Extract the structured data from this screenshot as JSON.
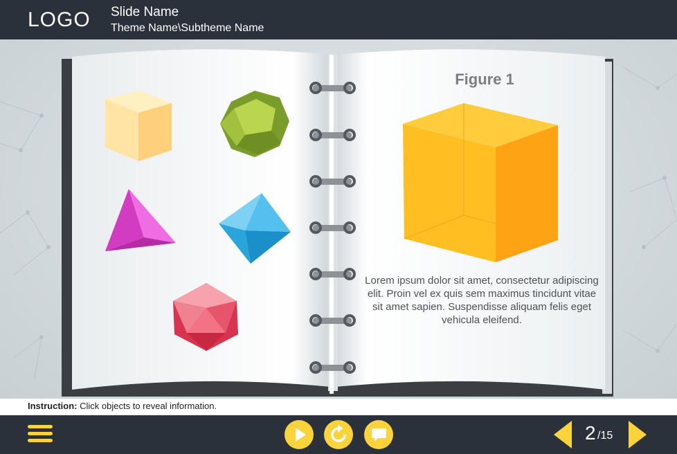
{
  "header": {
    "logo": "LOGO",
    "slide_name": "Slide Name",
    "theme_name": "Theme Name\\Subtheme Name"
  },
  "book": {
    "figure_title": "Figure 1",
    "body_text": "Lorem ipsum dolor sit amet, consectetur adipiscing elit. Proin vel ex quis sem maximus tincidunt vitae sit amet sapien. Suspendisse aliquam felis eget vehicula eleifend.",
    "shapes": [
      {
        "name": "cube",
        "color": "#ffd98c"
      },
      {
        "name": "dodecahedron",
        "color": "#8fb83a"
      },
      {
        "name": "tetrahedron",
        "color": "#e84fd6"
      },
      {
        "name": "octahedron",
        "color": "#39b6ea"
      },
      {
        "name": "icosahedron",
        "color": "#ee5b70"
      }
    ],
    "figure_shape": {
      "name": "large-cube",
      "color": "#fdb31d"
    }
  },
  "instruction": {
    "label": "Instruction:",
    "text": "Click objects to reveal information."
  },
  "footer": {
    "menu_icon": "hamburger-menu-icon",
    "play_icon": "play-icon",
    "replay_icon": "replay-icon",
    "comment_icon": "speech-bubble-icon",
    "page_current": "2",
    "page_total": "/15",
    "accent": "#fcd33b"
  }
}
